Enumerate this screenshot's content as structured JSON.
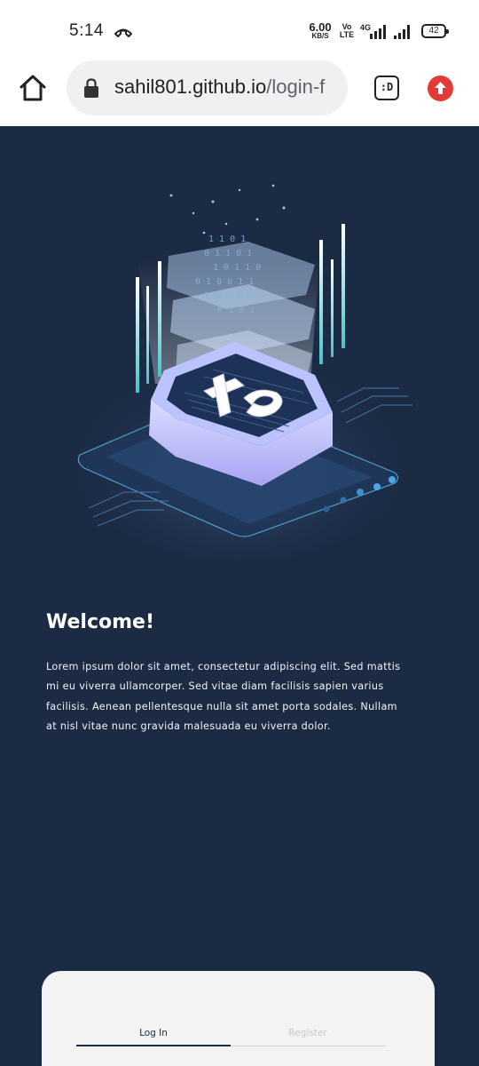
{
  "status_bar": {
    "time": "5:14",
    "speed_value": "6.00",
    "speed_unit": "KB/S",
    "volte_top": "Vo",
    "volte_bottom": "LTE",
    "network": "4G",
    "battery": "42"
  },
  "browser": {
    "url_host": "sahil801.github.io",
    "url_path": "/login-f",
    "tabs_label": ":D"
  },
  "page": {
    "welcome_title": "Welcome!",
    "welcome_text": "Lorem ipsum dolor sit amet, consectetur adipiscing elit. Sed mattis mi eu viverra ullamcorper. Sed vitae diam facilisis sapien varius facilisis. Aenean pellentesque nulla sit amet porta sodales. Nullam at nisl vitae nunc gravida malesuada eu viverra dolor.",
    "tabs": {
      "login": "Log In",
      "register": "Register"
    }
  },
  "colors": {
    "page_bg": "#1c2b44",
    "card_bg": "#f3f3f3",
    "accent_upload": "#e53935"
  },
  "icons": [
    "call-end-icon",
    "signal-icon",
    "battery-icon",
    "home-icon",
    "lock-icon",
    "tabs-icon",
    "upload-icon"
  ]
}
